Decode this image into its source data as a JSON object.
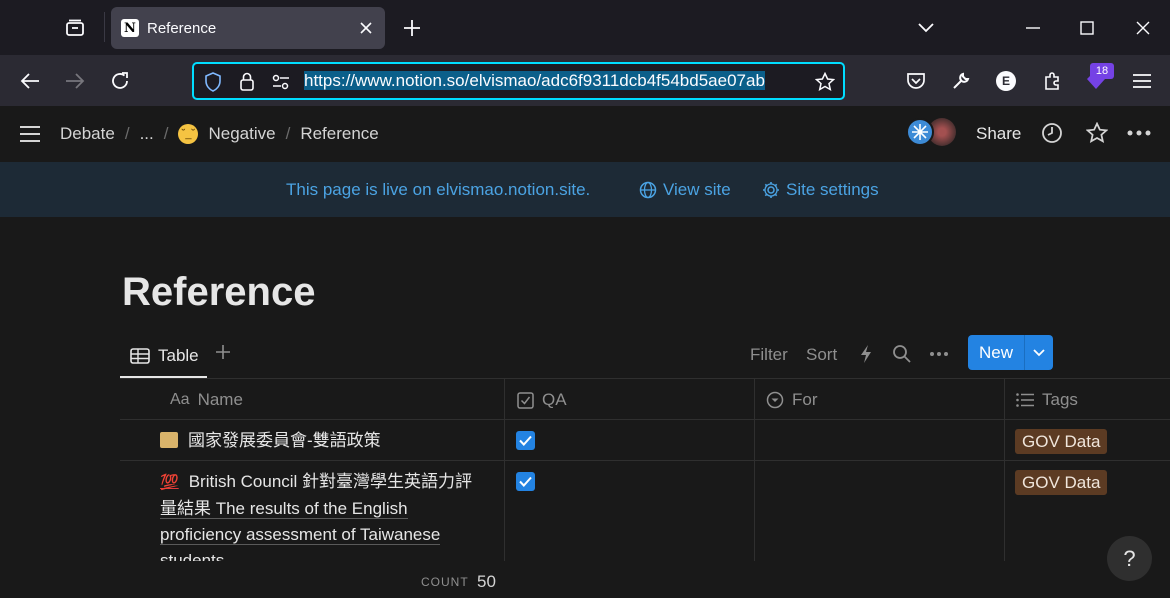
{
  "browser": {
    "tab_title": "Reference",
    "tab_favicon": "N",
    "url": "https://www.notion.so/elvismao/adc6f9311dcb4f54bd5ae07ab",
    "extension_badge": "18",
    "extension_letter": "E"
  },
  "topbar": {
    "breadcrumbs": [
      "Debate",
      "...",
      "Negative",
      "Reference"
    ],
    "share_label": "Share"
  },
  "banner": {
    "message": "This page is live on elvismao.notion.site.",
    "view_site": "View site",
    "site_settings": "Site settings"
  },
  "page": {
    "title": "Reference"
  },
  "view": {
    "tab_label": "Table",
    "filter": "Filter",
    "sort": "Sort",
    "new": "New"
  },
  "table": {
    "columns": [
      {
        "icon": "text-icon",
        "icon_text": "Aa",
        "label": "Name"
      },
      {
        "icon": "checkbox-icon",
        "label": "QA"
      },
      {
        "icon": "select-icon",
        "label": "For"
      },
      {
        "icon": "list-icon",
        "label": "Tags"
      }
    ],
    "rows": [
      {
        "emoji": "scroll-icon",
        "name": "國家發展委員會-雙語政策",
        "qa": true,
        "for": "",
        "tag": "GOV Data"
      },
      {
        "emoji": "hundred-points-icon",
        "emoji_text": "💯",
        "name_line1": "British Council 針對臺灣學生英語力評",
        "name_line2": "量結果 The results of the English",
        "name_line3": "proficiency assessment of Taiwanese",
        "name_line4": "students",
        "qa": true,
        "for": "",
        "tag": "GOV Data"
      }
    ]
  },
  "footer": {
    "count_label": "COUNT",
    "count_value": "50"
  },
  "help": "?",
  "colors": {
    "accent": "#2383e2",
    "banner_text": "#4ba3e3",
    "tag_bg": "#5c3b23",
    "url_focus": "#00ddff"
  }
}
